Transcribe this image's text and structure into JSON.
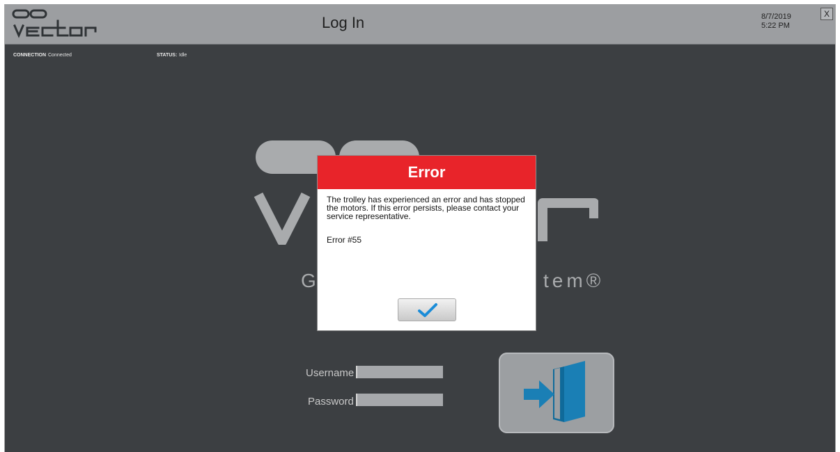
{
  "header": {
    "title": "Log In",
    "date": "8/7/2019",
    "time": "5:22 PM",
    "close_label": "X"
  },
  "statusbar": {
    "connection_label": "CONNECTION",
    "connection_value": "Connected",
    "status_label": "STATUS:",
    "status_value": "Idle"
  },
  "brand": {
    "tagline_left": "G",
    "tagline_right": "tem®"
  },
  "login": {
    "username_label": "Username",
    "password_label": "Password",
    "username_value": "",
    "password_value": ""
  },
  "dialog": {
    "title": "Error",
    "message": "The trolley has experienced an error and has stopped the motors. If this error persists, please contact your service representative.",
    "code": "Error #55",
    "ok_icon": "checkmark-icon"
  },
  "colors": {
    "background": "#3c3f42",
    "header": "#9c9ea1",
    "error_red": "#e8242a",
    "accent_blue": "#1a7fb5"
  }
}
